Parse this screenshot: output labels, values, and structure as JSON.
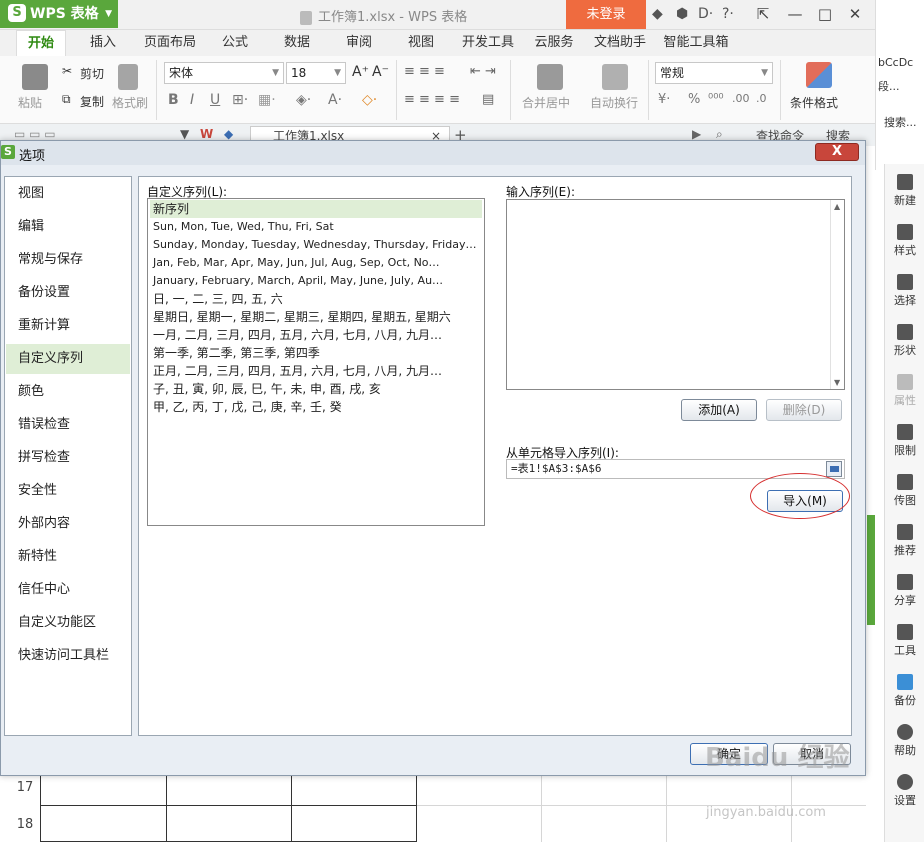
{
  "app": {
    "name": "WPS 表格",
    "doc_title": "工作簿1.xlsx - WPS 表格",
    "login": "未登录"
  },
  "ribbon_tabs": [
    "开始",
    "插入",
    "页面布局",
    "公式",
    "数据",
    "审阅",
    "视图",
    "开发工具",
    "云服务",
    "文档助手",
    "智能工具箱"
  ],
  "toolbar": {
    "paste": "粘贴",
    "cut": "剪切",
    "copy": "复制",
    "format_painter": "格式刷",
    "font": "宋体",
    "font_size": "18",
    "merge": "合并居中",
    "wrap": "自动换行",
    "number_format": "常规",
    "cond_format": "条件格式",
    "search_cmd": "查找命令",
    "search": "搜索"
  },
  "doc_tab": "工作簿1.xlsx",
  "right_peek": {
    "style_sample": "bCcDc",
    "paragraph": "段...",
    "search": "搜索..."
  },
  "right_sidebar": [
    "新建",
    "样式",
    "选择",
    "形状",
    "属性",
    "限制",
    "传图",
    "推荐",
    "分享",
    "工具",
    "备份",
    "帮助",
    "设置"
  ],
  "dialog": {
    "title": "选项",
    "close": "X",
    "categories": [
      "视图",
      "编辑",
      "常规与保存",
      "备份设置",
      "重新计算",
      "自定义序列",
      "颜色",
      "错误检查",
      "拼写检查",
      "安全性",
      "外部内容",
      "新特性",
      "信任中心",
      "自定义功能区",
      "快速访问工具栏"
    ],
    "active_category": "自定义序列",
    "custom_lists_label": "自定义序列(L):",
    "custom_lists": [
      "新序列",
      "Sun, Mon, Tue, Wed, Thu, Fri, Sat",
      "Sunday, Monday, Tuesday, Wednesday, Thursday, Friday…",
      "Jan, Feb, Mar, Apr, May, Jun, Jul, Aug, Sep, Oct, No…",
      "January, February, March, April, May, June, July, Au…",
      "日, 一, 二, 三, 四, 五, 六",
      "星期日, 星期一, 星期二, 星期三, 星期四, 星期五, 星期六",
      "一月, 二月, 三月, 四月, 五月, 六月, 七月, 八月, 九月…",
      "第一季, 第二季, 第三季, 第四季",
      "正月, 二月, 三月, 四月, 五月, 六月, 七月, 八月, 九月…",
      "子, 丑, 寅, 卯, 辰, 巳, 午, 未, 申, 酉, 戌, 亥",
      "甲, 乙, 丙, 丁, 戊, 己, 庚, 辛, 壬, 癸"
    ],
    "entry_label": "输入序列(E):",
    "entry_value": "",
    "add": "添加(A)",
    "delete": "删除(D)",
    "import_label": "从单元格导入序列(I):",
    "import_value": "=表1!$A$3:$A$6",
    "import": "导入(M)",
    "ok": "确定",
    "cancel": "取消"
  },
  "grid_rows": [
    "17",
    "18"
  ],
  "watermark": "Baidu 经验",
  "watermark_sub": "jingyan.baidu.com",
  "colors": {
    "brand_green": "#5aa73c",
    "login_orange": "#ef6b3f",
    "highlight_red": "#d62f2f",
    "selection_green": "#dfeed6"
  }
}
